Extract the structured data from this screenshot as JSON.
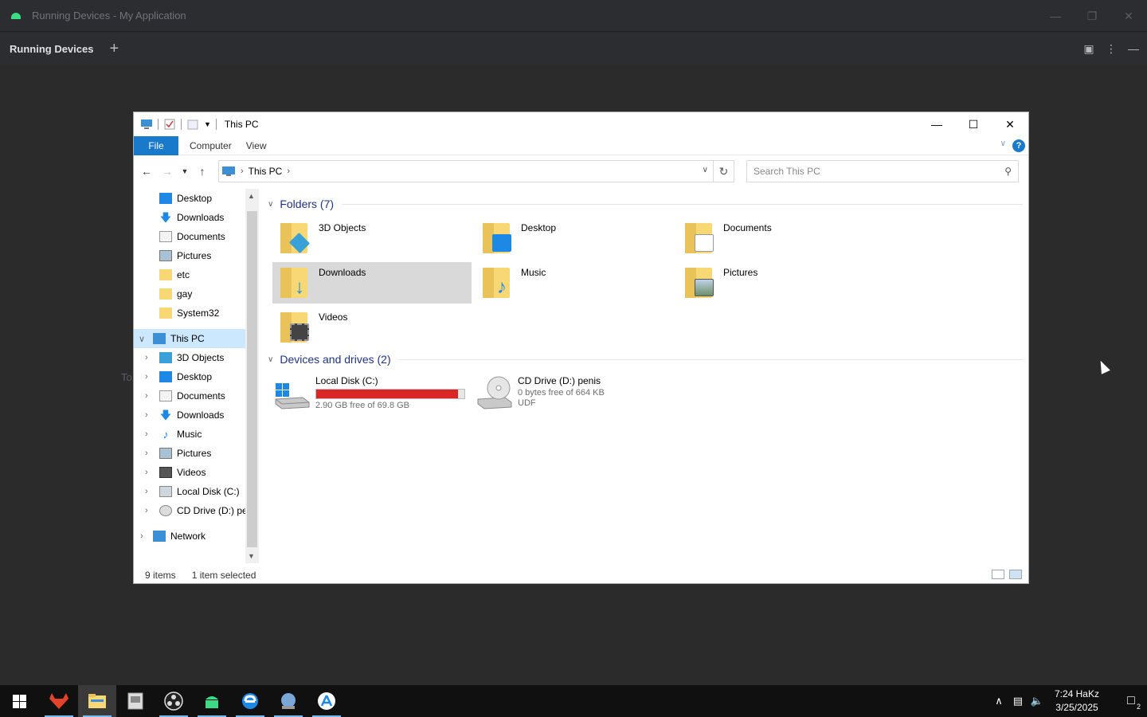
{
  "ide": {
    "window_title": "Running Devices - My Application",
    "tool_title": "Running Devices",
    "add_tab_icon": "+",
    "ghost_text": "To"
  },
  "explorer": {
    "title": "This PC",
    "ribbon_tabs": [
      "File",
      "Computer",
      "View"
    ],
    "help_label": "?",
    "address_crumb": "This PC",
    "search_placeholder": "Search This PC",
    "nav": {
      "quick_access": [
        {
          "label": "Desktop",
          "icon": "desktop-icon",
          "pinned": true
        },
        {
          "label": "Downloads",
          "icon": "downloads-icon",
          "pinned": true
        },
        {
          "label": "Documents",
          "icon": "documents-icon",
          "pinned": true
        },
        {
          "label": "Pictures",
          "icon": "pictures-icon",
          "pinned": true
        },
        {
          "label": "etc",
          "icon": "folder-icon",
          "pinned": false
        },
        {
          "label": "gay",
          "icon": "folder-icon",
          "pinned": false
        },
        {
          "label": "System32",
          "icon": "folder-icon",
          "pinned": false
        }
      ],
      "this_pc": "This PC",
      "this_pc_children": [
        {
          "label": "3D Objects",
          "icon": "3d-objects-icon"
        },
        {
          "label": "Desktop",
          "icon": "desktop-icon"
        },
        {
          "label": "Documents",
          "icon": "documents-icon"
        },
        {
          "label": "Downloads",
          "icon": "downloads-icon"
        },
        {
          "label": "Music",
          "icon": "music-icon"
        },
        {
          "label": "Pictures",
          "icon": "pictures-icon"
        },
        {
          "label": "Videos",
          "icon": "videos-icon"
        },
        {
          "label": "Local Disk (C:)",
          "icon": "local-disk-icon"
        },
        {
          "label": "CD Drive (D:) penis",
          "icon": "cd-drive-icon"
        }
      ],
      "network": "Network"
    },
    "folders_header": "Folders (7)",
    "folders": [
      {
        "label": "3D Objects",
        "overlay": "#3aa0d8"
      },
      {
        "label": "Desktop",
        "overlay": "#1e88e5"
      },
      {
        "label": "Documents",
        "overlay": "#ffffff"
      },
      {
        "label": "Downloads",
        "overlay": "#1e88e5"
      },
      {
        "label": "Music",
        "overlay": "#1e88e5"
      },
      {
        "label": "Pictures",
        "overlay": "#7fa7c9"
      },
      {
        "label": "Videos",
        "overlay": "#555555"
      }
    ],
    "selected_folder": "Downloads",
    "drives_header": "Devices and drives (2)",
    "drives": [
      {
        "name": "Local Disk (C:)",
        "detail": "2.90 GB free of 69.8 GB",
        "used_fraction": 0.958
      },
      {
        "name": "CD Drive (D:) penis",
        "detail": "0 bytes free of 664 KB",
        "fs": "UDF"
      }
    ],
    "status": {
      "items": "9 items",
      "selected": "1 item selected"
    }
  },
  "taskbar": {
    "apps": [
      "start-icon",
      "gitlab-fox-icon",
      "file-explorer-icon",
      "app-installer-icon",
      "obs-icon",
      "android-icon",
      "edge-icon",
      "network-globe-icon",
      "app-store-icon"
    ],
    "time": "7:24 HaKz",
    "date": "3/25/2025",
    "notification_count": "2"
  },
  "colors": {
    "accent": "#1979ca",
    "selection": "#cce8ff",
    "disk_bar": "#da2626",
    "group_header": "#1e3287"
  }
}
